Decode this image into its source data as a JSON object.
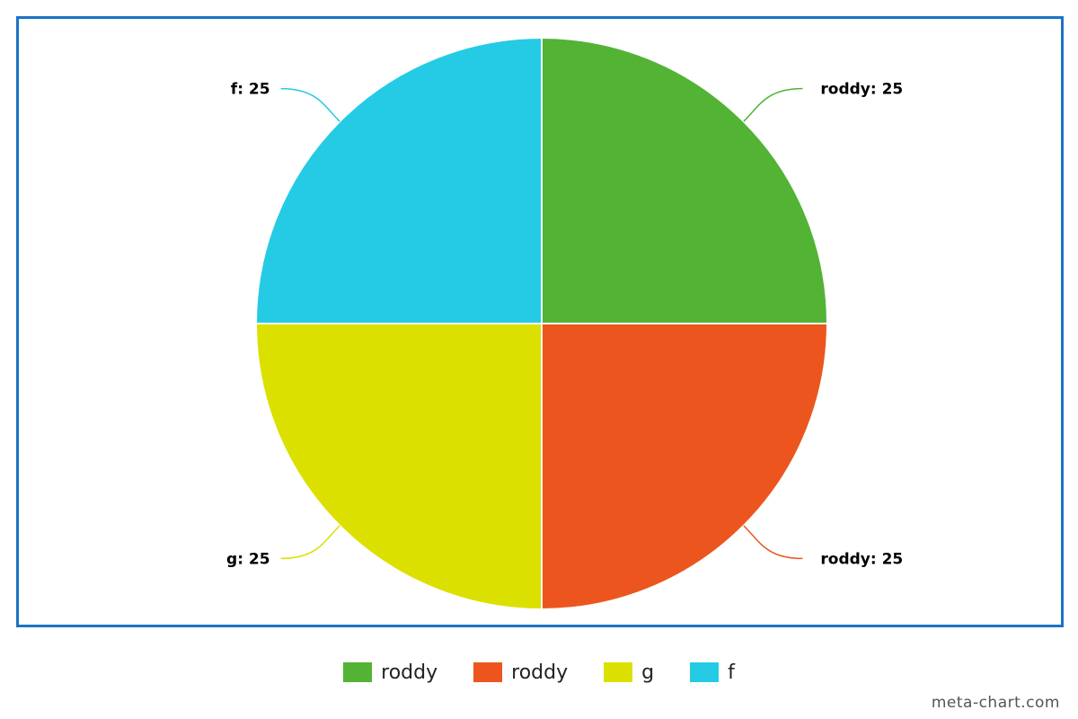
{
  "chart_data": {
    "type": "pie",
    "slices": [
      {
        "label": "roddy",
        "value": 25,
        "color": "#52b335",
        "data_label": "roddy: 25"
      },
      {
        "label": "roddy",
        "value": 25,
        "color": "#ec561e",
        "data_label": "roddy: 25"
      },
      {
        "label": "g",
        "value": 25,
        "color": "#dce000",
        "data_label": "g: 25"
      },
      {
        "label": "f",
        "value": 25,
        "color": "#25cbe4",
        "data_label": "f: 25"
      }
    ],
    "legend_position": "bottom",
    "slice_border_color": "#ffffff",
    "frame_border_color": "#1a73c5"
  },
  "watermark": "meta-chart.com"
}
